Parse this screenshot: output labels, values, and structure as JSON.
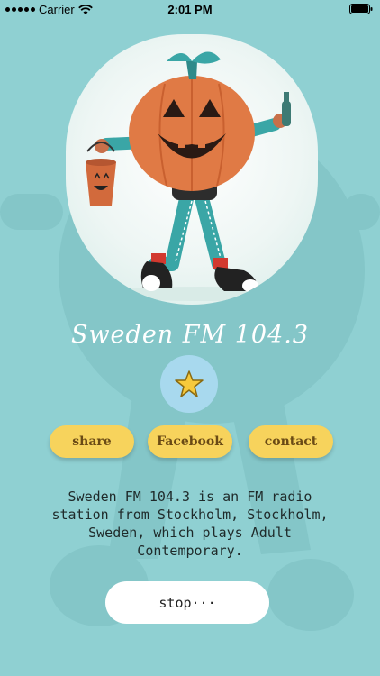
{
  "status_bar": {
    "carrier": "Carrier",
    "time": "2:01 PM",
    "wifi_icon": "wifi-icon",
    "battery_icon": "battery-icon"
  },
  "station": {
    "title": "Sweden FM 104.3",
    "description": "Sweden FM 104.3 is an FM radio station from Stockholm, Stockholm, Sweden, which plays Adult Contemporary.",
    "artwork_icon": "pumpkin-character-illustration"
  },
  "favorite": {
    "icon": "star-icon"
  },
  "actions": {
    "share_label": "share",
    "facebook_label": "Facebook",
    "contact_label": "contact"
  },
  "player": {
    "stop_label": "stop···"
  },
  "colors": {
    "background": "#8fd0d2",
    "pill": "#f7d35c",
    "pill_text": "#6a4a15",
    "favorite_bg": "#a8d9ee",
    "star": "#f6c93b",
    "pumpkin": "#e07a45"
  }
}
